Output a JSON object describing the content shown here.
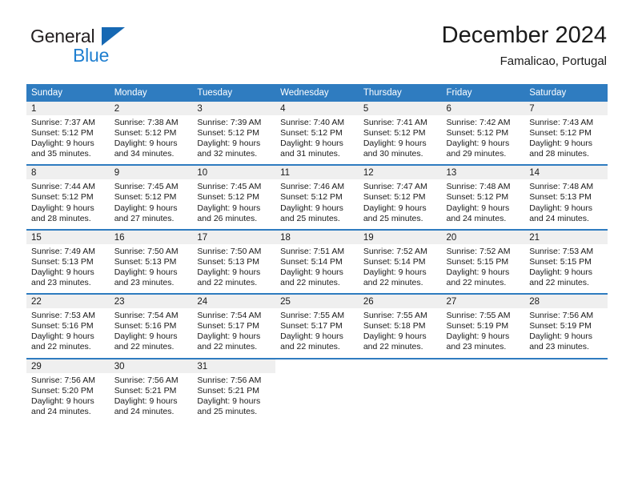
{
  "brand": {
    "name_top": "General",
    "name_bottom": "Blue"
  },
  "header": {
    "title": "December 2024",
    "location": "Famalicao, Portugal"
  },
  "colors": {
    "header_blue": "#2f7cc0",
    "brand_blue": "#1f7fd0",
    "daynum_bg": "#efefef"
  },
  "weekdays": [
    "Sunday",
    "Monday",
    "Tuesday",
    "Wednesday",
    "Thursday",
    "Friday",
    "Saturday"
  ],
  "weeks": [
    [
      {
        "day": "1",
        "sunrise": "Sunrise: 7:37 AM",
        "sunset": "Sunset: 5:12 PM",
        "daylight_l1": "Daylight: 9 hours",
        "daylight_l2": "and 35 minutes."
      },
      {
        "day": "2",
        "sunrise": "Sunrise: 7:38 AM",
        "sunset": "Sunset: 5:12 PM",
        "daylight_l1": "Daylight: 9 hours",
        "daylight_l2": "and 34 minutes."
      },
      {
        "day": "3",
        "sunrise": "Sunrise: 7:39 AM",
        "sunset": "Sunset: 5:12 PM",
        "daylight_l1": "Daylight: 9 hours",
        "daylight_l2": "and 32 minutes."
      },
      {
        "day": "4",
        "sunrise": "Sunrise: 7:40 AM",
        "sunset": "Sunset: 5:12 PM",
        "daylight_l1": "Daylight: 9 hours",
        "daylight_l2": "and 31 minutes."
      },
      {
        "day": "5",
        "sunrise": "Sunrise: 7:41 AM",
        "sunset": "Sunset: 5:12 PM",
        "daylight_l1": "Daylight: 9 hours",
        "daylight_l2": "and 30 minutes."
      },
      {
        "day": "6",
        "sunrise": "Sunrise: 7:42 AM",
        "sunset": "Sunset: 5:12 PM",
        "daylight_l1": "Daylight: 9 hours",
        "daylight_l2": "and 29 minutes."
      },
      {
        "day": "7",
        "sunrise": "Sunrise: 7:43 AM",
        "sunset": "Sunset: 5:12 PM",
        "daylight_l1": "Daylight: 9 hours",
        "daylight_l2": "and 28 minutes."
      }
    ],
    [
      {
        "day": "8",
        "sunrise": "Sunrise: 7:44 AM",
        "sunset": "Sunset: 5:12 PM",
        "daylight_l1": "Daylight: 9 hours",
        "daylight_l2": "and 28 minutes."
      },
      {
        "day": "9",
        "sunrise": "Sunrise: 7:45 AM",
        "sunset": "Sunset: 5:12 PM",
        "daylight_l1": "Daylight: 9 hours",
        "daylight_l2": "and 27 minutes."
      },
      {
        "day": "10",
        "sunrise": "Sunrise: 7:45 AM",
        "sunset": "Sunset: 5:12 PM",
        "daylight_l1": "Daylight: 9 hours",
        "daylight_l2": "and 26 minutes."
      },
      {
        "day": "11",
        "sunrise": "Sunrise: 7:46 AM",
        "sunset": "Sunset: 5:12 PM",
        "daylight_l1": "Daylight: 9 hours",
        "daylight_l2": "and 25 minutes."
      },
      {
        "day": "12",
        "sunrise": "Sunrise: 7:47 AM",
        "sunset": "Sunset: 5:12 PM",
        "daylight_l1": "Daylight: 9 hours",
        "daylight_l2": "and 25 minutes."
      },
      {
        "day": "13",
        "sunrise": "Sunrise: 7:48 AM",
        "sunset": "Sunset: 5:12 PM",
        "daylight_l1": "Daylight: 9 hours",
        "daylight_l2": "and 24 minutes."
      },
      {
        "day": "14",
        "sunrise": "Sunrise: 7:48 AM",
        "sunset": "Sunset: 5:13 PM",
        "daylight_l1": "Daylight: 9 hours",
        "daylight_l2": "and 24 minutes."
      }
    ],
    [
      {
        "day": "15",
        "sunrise": "Sunrise: 7:49 AM",
        "sunset": "Sunset: 5:13 PM",
        "daylight_l1": "Daylight: 9 hours",
        "daylight_l2": "and 23 minutes."
      },
      {
        "day": "16",
        "sunrise": "Sunrise: 7:50 AM",
        "sunset": "Sunset: 5:13 PM",
        "daylight_l1": "Daylight: 9 hours",
        "daylight_l2": "and 23 minutes."
      },
      {
        "day": "17",
        "sunrise": "Sunrise: 7:50 AM",
        "sunset": "Sunset: 5:13 PM",
        "daylight_l1": "Daylight: 9 hours",
        "daylight_l2": "and 22 minutes."
      },
      {
        "day": "18",
        "sunrise": "Sunrise: 7:51 AM",
        "sunset": "Sunset: 5:14 PM",
        "daylight_l1": "Daylight: 9 hours",
        "daylight_l2": "and 22 minutes."
      },
      {
        "day": "19",
        "sunrise": "Sunrise: 7:52 AM",
        "sunset": "Sunset: 5:14 PM",
        "daylight_l1": "Daylight: 9 hours",
        "daylight_l2": "and 22 minutes."
      },
      {
        "day": "20",
        "sunrise": "Sunrise: 7:52 AM",
        "sunset": "Sunset: 5:15 PM",
        "daylight_l1": "Daylight: 9 hours",
        "daylight_l2": "and 22 minutes."
      },
      {
        "day": "21",
        "sunrise": "Sunrise: 7:53 AM",
        "sunset": "Sunset: 5:15 PM",
        "daylight_l1": "Daylight: 9 hours",
        "daylight_l2": "and 22 minutes."
      }
    ],
    [
      {
        "day": "22",
        "sunrise": "Sunrise: 7:53 AM",
        "sunset": "Sunset: 5:16 PM",
        "daylight_l1": "Daylight: 9 hours",
        "daylight_l2": "and 22 minutes."
      },
      {
        "day": "23",
        "sunrise": "Sunrise: 7:54 AM",
        "sunset": "Sunset: 5:16 PM",
        "daylight_l1": "Daylight: 9 hours",
        "daylight_l2": "and 22 minutes."
      },
      {
        "day": "24",
        "sunrise": "Sunrise: 7:54 AM",
        "sunset": "Sunset: 5:17 PM",
        "daylight_l1": "Daylight: 9 hours",
        "daylight_l2": "and 22 minutes."
      },
      {
        "day": "25",
        "sunrise": "Sunrise: 7:55 AM",
        "sunset": "Sunset: 5:17 PM",
        "daylight_l1": "Daylight: 9 hours",
        "daylight_l2": "and 22 minutes."
      },
      {
        "day": "26",
        "sunrise": "Sunrise: 7:55 AM",
        "sunset": "Sunset: 5:18 PM",
        "daylight_l1": "Daylight: 9 hours",
        "daylight_l2": "and 22 minutes."
      },
      {
        "day": "27",
        "sunrise": "Sunrise: 7:55 AM",
        "sunset": "Sunset: 5:19 PM",
        "daylight_l1": "Daylight: 9 hours",
        "daylight_l2": "and 23 minutes."
      },
      {
        "day": "28",
        "sunrise": "Sunrise: 7:56 AM",
        "sunset": "Sunset: 5:19 PM",
        "daylight_l1": "Daylight: 9 hours",
        "daylight_l2": "and 23 minutes."
      }
    ],
    [
      {
        "day": "29",
        "sunrise": "Sunrise: 7:56 AM",
        "sunset": "Sunset: 5:20 PM",
        "daylight_l1": "Daylight: 9 hours",
        "daylight_l2": "and 24 minutes."
      },
      {
        "day": "30",
        "sunrise": "Sunrise: 7:56 AM",
        "sunset": "Sunset: 5:21 PM",
        "daylight_l1": "Daylight: 9 hours",
        "daylight_l2": "and 24 minutes."
      },
      {
        "day": "31",
        "sunrise": "Sunrise: 7:56 AM",
        "sunset": "Sunset: 5:21 PM",
        "daylight_l1": "Daylight: 9 hours",
        "daylight_l2": "and 25 minutes."
      },
      {
        "day": "",
        "sunrise": "",
        "sunset": "",
        "daylight_l1": "",
        "daylight_l2": ""
      },
      {
        "day": "",
        "sunrise": "",
        "sunset": "",
        "daylight_l1": "",
        "daylight_l2": ""
      },
      {
        "day": "",
        "sunrise": "",
        "sunset": "",
        "daylight_l1": "",
        "daylight_l2": ""
      },
      {
        "day": "",
        "sunrise": "",
        "sunset": "",
        "daylight_l1": "",
        "daylight_l2": ""
      }
    ]
  ]
}
